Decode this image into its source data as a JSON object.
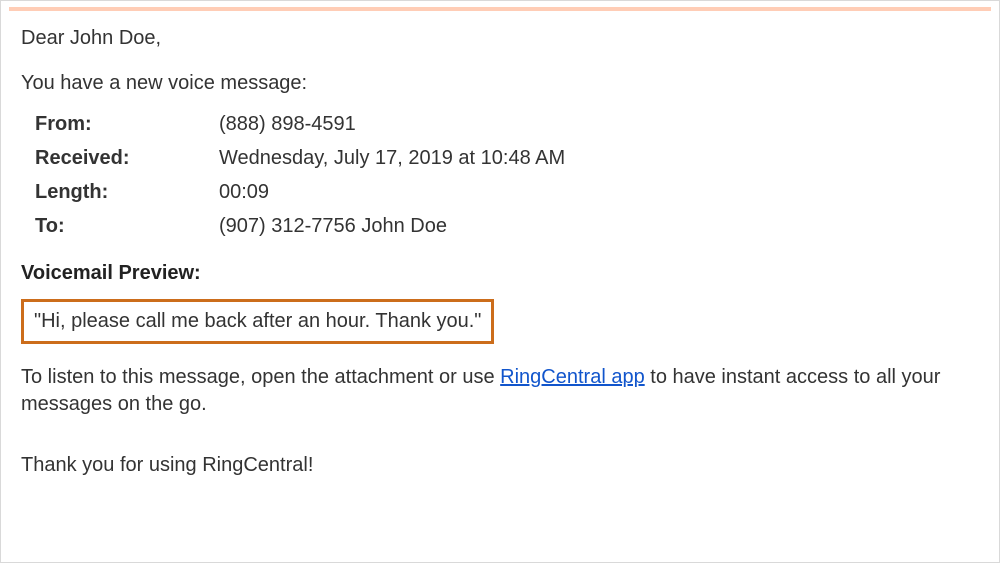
{
  "greeting": "Dear John Doe,",
  "intro": "You have a new voice message:",
  "details": {
    "from_label": "From:",
    "from_value": "(888) 898-4591",
    "received_label": "Received:",
    "received_value": "Wednesday, July 17, 2019 at 10:48 AM",
    "length_label": "Length:",
    "length_value": "00:09",
    "to_label": "To:",
    "to_value": "(907) 312-7756 John Doe"
  },
  "preview_heading": "Voicemail Preview:",
  "preview_text": "\"Hi, please call me back after an hour. Thank you.\"",
  "instruction_before": "To listen to this message, open the attachment or use ",
  "instruction_link": "RingCentral app",
  "instruction_after": " to have instant access to all your messages on the go.",
  "thanks": "Thank you for using RingCentral!"
}
